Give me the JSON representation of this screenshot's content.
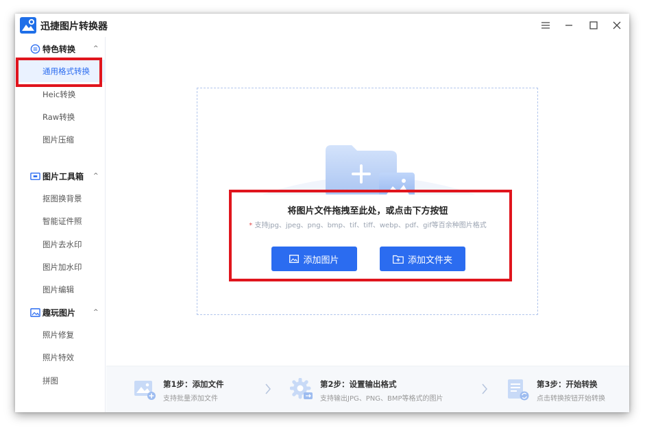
{
  "app": {
    "title": "迅捷图片转换器"
  },
  "sidebar": {
    "sections": [
      {
        "label": "特色转换",
        "items": [
          "通用格式转换",
          "Heic转换",
          "Raw转换",
          "图片压缩"
        ]
      },
      {
        "label": "图片工具箱",
        "items": [
          "抠图换背景",
          "智能证件照",
          "图片去水印",
          "图片加水印",
          "图片编辑"
        ]
      },
      {
        "label": "趣玩图片",
        "items": [
          "照片修复",
          "照片特效",
          "拼图"
        ]
      }
    ],
    "caret": "^",
    "active_item": "通用格式转换"
  },
  "main": {
    "drop_title": "将图片文件拖拽至此处，或点击下方按钮",
    "drop_star": "*",
    "drop_sub": "支持jpg、jpeg、png、bmp、tif、tiff、webp、pdf、gif等百余种图片格式",
    "add_image_label": "添加图片",
    "add_folder_label": "添加文件夹"
  },
  "steps": [
    {
      "title": "第1步：添加文件",
      "desc": "支持批量添加文件",
      "icon": "image-add-icon"
    },
    {
      "title": "第2步：设置输出格式",
      "desc": "支持输出JPG、PNG、BMP等格式的图片",
      "icon": "gear-icon"
    },
    {
      "title": "第3步：开始转换",
      "desc": "点击转换按钮开始转换",
      "icon": "convert-icon"
    }
  ],
  "colors": {
    "accent": "#2b6cf0",
    "highlight": "#e0151d",
    "active_bg": "#eaf2ff"
  }
}
